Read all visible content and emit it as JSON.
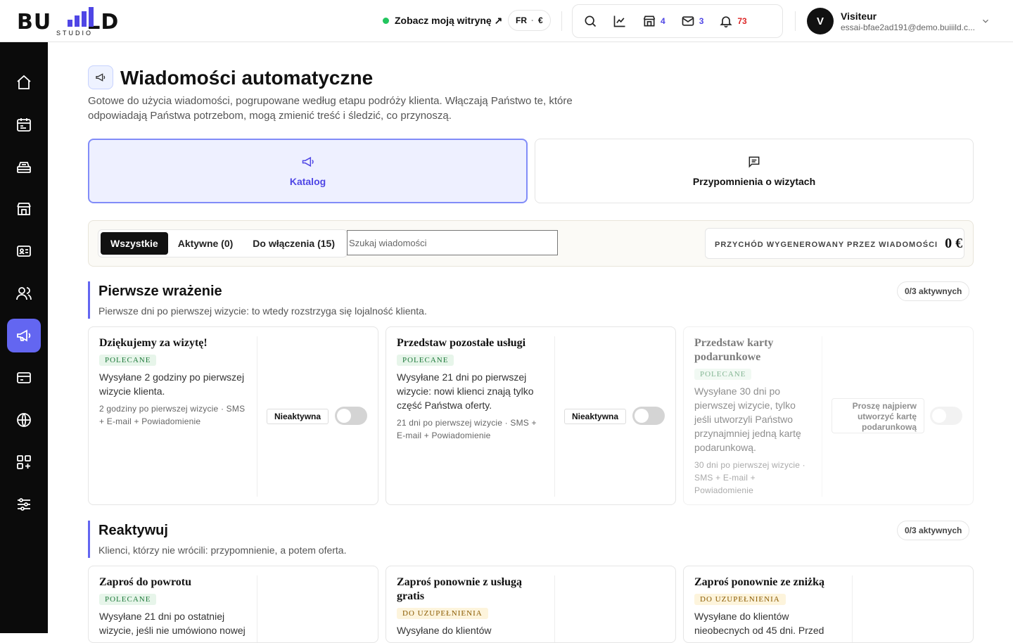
{
  "brand": {
    "logo_word_left": "BU",
    "logo_word_right": "LD",
    "logo_sub": "STUDIO"
  },
  "header": {
    "site_link": "Zobacz moją witrynę ↗",
    "lang": "FR",
    "currency": "€",
    "counts": {
      "shop": "4",
      "mail": "3",
      "bell": "73"
    },
    "user": {
      "initial": "V",
      "name": "Visiteur",
      "email": "essai-bfae2ad191@demo.buiiild.c..."
    }
  },
  "sidebar": {
    "active": "megaphone-icon"
  },
  "page": {
    "title": "Wiadomości automatyczne",
    "description": "Gotowe do użycia wiadomości, pogrupowane według etapu podróży klienta. Włączają Państwo te, które odpowiadają Państwa potrzebom, mogą zmienić treść i śledzić, co przynoszą."
  },
  "tabs": [
    {
      "label": "Katalog"
    },
    {
      "label": "Przypomnienia o wizytach"
    }
  ],
  "filters": {
    "all": "Wszystkie",
    "active": "Aktywne (0)",
    "to_enable": "Do włączenia (15)",
    "search_placeholder": "Szukaj wiadomości",
    "revenue_label": "PRZYCHÓD WYGENEROWANY PRZEZ WIADOMOŚCI",
    "revenue_value": "0 €"
  },
  "sections": [
    {
      "title": "Pierwsze wrażenie",
      "description": "Pierwsze dni po pierwszej wizycie: to wtedy rozstrzyga się lojalność klienta.",
      "badge": "0/3 aktywnych",
      "cards": [
        {
          "title": "Dziękujemy za wizytę!",
          "tag": "POLECANE",
          "desc": "Wysyłane 2 godziny po pierwszej wizycie klienta.",
          "meta": "2 godziny po pierwszej wizycie · SMS + E-mail + Powiadomienie",
          "status": "Nieaktywna"
        },
        {
          "title": "Przedstaw pozostałe usługi",
          "tag": "POLECANE",
          "desc": "Wysyłane 21 dni po pierwszej wizycie: nowi klienci znają tylko część Państwa oferty.",
          "meta": "21 dni po pierwszej wizycie · SMS + E-mail + Powiadomienie",
          "status": "Nieaktywna"
        },
        {
          "title": "Przedstaw karty podarunkowe",
          "tag": "POLECANE",
          "desc": "Wysyłane 30 dni po pierwszej wizycie, tylko jeśli utworzyli Państwo przynajmniej jedną kartę podarunkową.",
          "meta": "30 dni po pierwszej wizycie · SMS + E-mail + Powiadomienie",
          "status": "Proszę najpierw utworzyć kartę podarunkową"
        }
      ]
    },
    {
      "title": "Reaktywuj",
      "description": "Klienci, którzy nie wrócili: przypomnienie, a potem oferta.",
      "badge": "0/3 aktywnych",
      "cards": [
        {
          "title": "Zaproś do powrotu",
          "tag": "POLECANE",
          "desc": "Wysyłane 21 dni po ostatniej wizycie, jeśli nie umówiono nowej"
        },
        {
          "title": "Zaproś ponownie z usługą gratis",
          "tag": "DO UZUPEŁNIENIA",
          "desc": "Wysyłane do klientów"
        },
        {
          "title": "Zaproś ponownie ze zniżką",
          "tag": "DO UZUPEŁNIENIA",
          "desc": "Wysyłane do klientów nieobecnych od 45 dni. Przed"
        }
      ]
    }
  ]
}
